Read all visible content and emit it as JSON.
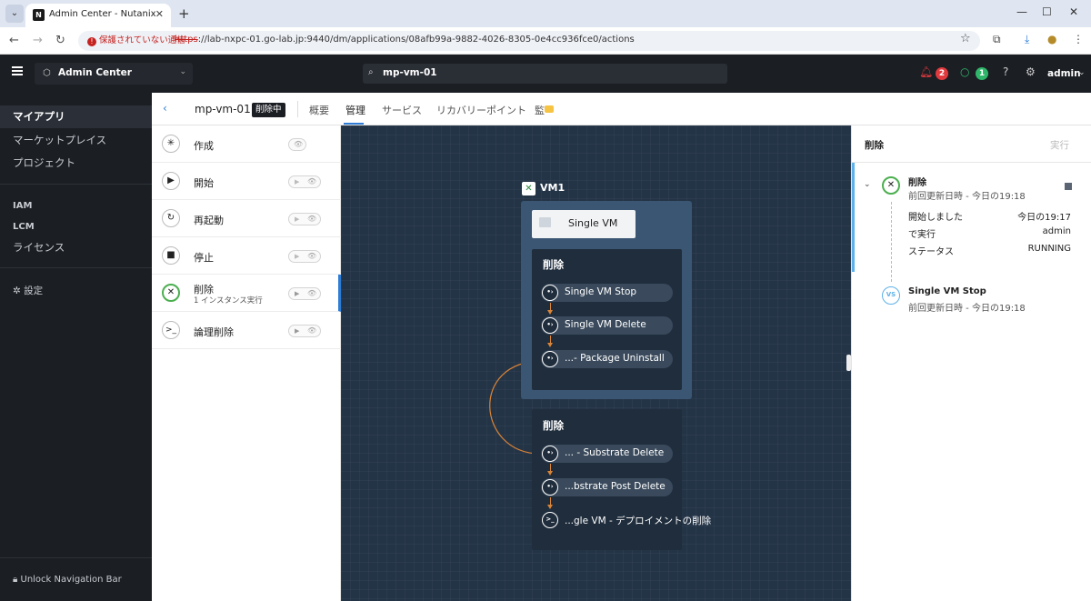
{
  "browser": {
    "tab_title": "Admin Center - Nutanix",
    "favicon_letter": "N",
    "security_label": "保護されていない通信",
    "url_scheme": "https",
    "url_rest": "://lab-nxpc-01.go-lab.jp:9440/dm/applications/08afb99a-9882-4026-8305-0e4cc936fce0/actions"
  },
  "header": {
    "app_switcher": "Admin Center",
    "search_value": "mp-vm-01",
    "alerts_count": "2",
    "tasks_count": "1",
    "user": "admin"
  },
  "sidebar": {
    "items": [
      {
        "label": "マイアプリ"
      },
      {
        "label": "マーケットプレイス"
      },
      {
        "label": "プロジェクト"
      },
      {
        "label": "IAM"
      },
      {
        "label": "LCM"
      },
      {
        "label": "ライセンス"
      },
      {
        "label": "設定"
      }
    ],
    "unlock_label": "Unlock Navigation Bar"
  },
  "subheader": {
    "app_name": "mp-vm-01",
    "state": "削除中",
    "tabs": [
      {
        "label": "概要"
      },
      {
        "label": "管理"
      },
      {
        "label": "サービス"
      },
      {
        "label": "リカバリーポイント"
      },
      {
        "label": "監"
      }
    ]
  },
  "actions": [
    {
      "label": "作成",
      "sub": "",
      "icon": "asterisk-icon"
    },
    {
      "label": "開始",
      "sub": "",
      "icon": "play-icon"
    },
    {
      "label": "再起動",
      "sub": "",
      "icon": "restart-icon"
    },
    {
      "label": "停止",
      "sub": "",
      "icon": "stop-icon"
    },
    {
      "label": "削除",
      "sub": "1 インスタンス実行",
      "icon": "close-icon"
    },
    {
      "label": "論理削除",
      "sub": "",
      "icon": "terminal-icon"
    }
  ],
  "canvas": {
    "vm_label": "VM1",
    "service_card": "Single VM",
    "group1": {
      "title": "削除",
      "tasks": [
        "Single VM Stop",
        "Single VM Delete",
        "...- Package Uninstall"
      ]
    },
    "group2": {
      "title": "削除",
      "tasks": [
        "... - Substrate Delete",
        "...bstrate Post Delete",
        "...gle VM - デプロイメントの削除"
      ]
    }
  },
  "right_panel": {
    "title": "削除",
    "run_label": "実行",
    "entry1": {
      "name": "削除",
      "time": "前回更新日時 - 今日の19:18",
      "kv": [
        {
          "k": "開始しました",
          "v": "今日の19:17"
        },
        {
          "k": "で実行",
          "v": "admin"
        },
        {
          "k": "ステータス",
          "v": "RUNNING"
        }
      ]
    },
    "entry2": {
      "icon_text": "VS",
      "name": "Single VM Stop",
      "time": "前回更新日時 - 今日の19:18"
    }
  }
}
